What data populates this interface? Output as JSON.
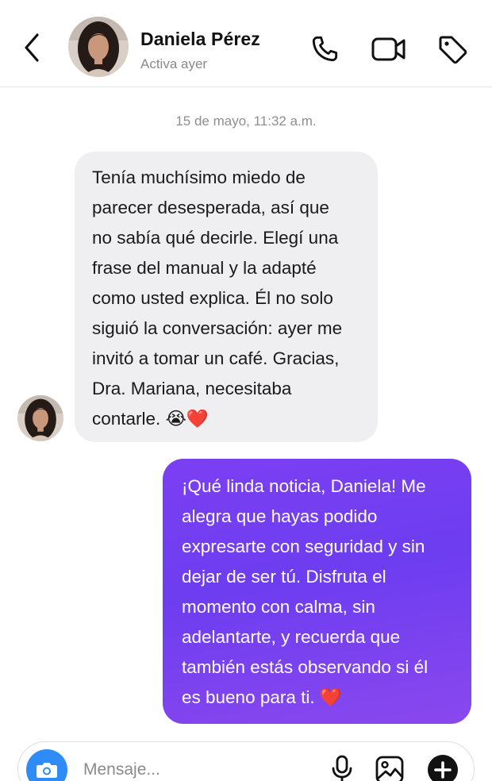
{
  "header": {
    "contact_name": "Daniela Pérez",
    "status": "Activa ayer",
    "icons": [
      "back-arrow-icon",
      "phone-icon",
      "video-camera-icon",
      "tag-icon"
    ]
  },
  "conversation": {
    "timestamp": "15 de mayo, 11:32 a.m.",
    "messages": [
      {
        "direction": "incoming",
        "text": "Tenía muchísimo miedo de\nparecer desesperada, así que\nno sabía qué decirle.  Elegí una\nfrase del manual y la adapté\ncomo usted explica. Él no solo\nsiguió la conversación: ayer me\ninvitó a tomar un café. Gracias,\nDra. Mariana, necesitaba\ncontarle. 😭❤️"
      },
      {
        "direction": "outgoing",
        "text": "¡Qué linda noticia, Daniela! Me\nalegra que hayas podido\nexpresarte con seguridad y sin\ndejar de ser tú. Disfruta el\nmomento con calma, sin\nadelantarte, y recuerda que\ntambién estás observando si él\nes bueno para ti. ❤️"
      }
    ]
  },
  "composer": {
    "placeholder": "Mensaje...",
    "value": "",
    "icons": [
      "camera-icon",
      "microphone-icon",
      "image-icon",
      "add-icon"
    ]
  },
  "colors": {
    "incoming_bubble": "#efeff1",
    "outgoing_bubble_start": "#7c3ff2",
    "outgoing_bubble_end": "#8a48ee",
    "camera_button": "#2f8cf6",
    "secondary_text": "#8a8a8a"
  }
}
